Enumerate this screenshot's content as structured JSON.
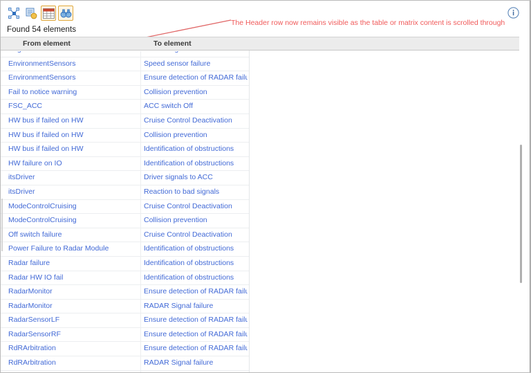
{
  "toolbar": {
    "buttons": [
      {
        "name": "select-related-elements-icon",
        "label": "Select Related Elements",
        "selected": false
      },
      {
        "name": "add-element-icon",
        "label": "Add Element",
        "selected": false
      },
      {
        "name": "table-view-icon",
        "label": "Table View",
        "selected": true
      },
      {
        "name": "find-binoculars-icon",
        "label": "Find",
        "selected": true
      }
    ]
  },
  "status": {
    "found_label": "Found 54 elements"
  },
  "annotation": {
    "text": "The Header row now remains visible as the table or matrix content is scrolled through",
    "color": "#f05a5a"
  },
  "info_button": {
    "name": "info-icon",
    "label": "i"
  },
  "table": {
    "columns": [
      {
        "key": "from",
        "label": "From element"
      },
      {
        "key": "to",
        "label": "To element"
      }
    ],
    "link_color": "#4169d6",
    "header_background": "#ececec",
    "rows": [
      {
        "from": "EngineControl",
        "to": "Loss of signals from Brake and E..."
      },
      {
        "from": "EnvironmentSensors",
        "to": "Speed sensor failure"
      },
      {
        "from": "EnvironmentSensors",
        "to": "Ensure detection of RADAR failu..."
      },
      {
        "from": "Fail to notice warning",
        "to": "Collision prevention"
      },
      {
        "from": "FSC_ACC",
        "to": "ACC switch Off"
      },
      {
        "from": "HW bus if failed on HW",
        "to": "Cruise Control Deactivation"
      },
      {
        "from": "HW bus if failed on HW",
        "to": "Collision prevention"
      },
      {
        "from": "HW bus if failed on HW",
        "to": "Identification of obstructions"
      },
      {
        "from": "HW failure on IO",
        "to": "Identification of obstructions"
      },
      {
        "from": "itsDriver",
        "to": "Driver signals to ACC"
      },
      {
        "from": "itsDriver",
        "to": "Reaction to bad signals"
      },
      {
        "from": "ModeControlCruising",
        "to": "Cruise Control Deactivation"
      },
      {
        "from": "ModeControlCruising",
        "to": "Collision prevention"
      },
      {
        "from": "Off switch failure",
        "to": "Cruise Control Deactivation"
      },
      {
        "from": "Power Failure to Radar Module",
        "to": "Identification of obstructions"
      },
      {
        "from": "Radar failure",
        "to": "Identification of obstructions"
      },
      {
        "from": "Radar HW IO fail",
        "to": "Identification of obstructions"
      },
      {
        "from": "RadarMonitor",
        "to": "Ensure detection of RADAR failu..."
      },
      {
        "from": "RadarMonitor",
        "to": "RADAR Signal failure"
      },
      {
        "from": "RadarSensorLF",
        "to": "Ensure detection of RADAR failu..."
      },
      {
        "from": "RadarSensorRF",
        "to": "Ensure detection of RADAR failu..."
      },
      {
        "from": "RdRArbitration",
        "to": "Ensure detection of RADAR failu..."
      },
      {
        "from": "RdRArbitration",
        "to": "RADAR Signal failure"
      }
    ]
  }
}
